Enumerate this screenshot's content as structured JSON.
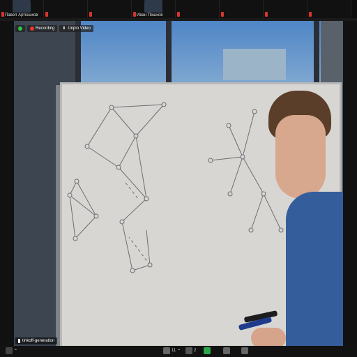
{
  "top_strip": {
    "tiles": [
      {
        "name": "Павел Артюшков"
      },
      {
        "name": ""
      },
      {
        "name": ""
      },
      {
        "name": "Иван Пешков"
      },
      {
        "name": ""
      },
      {
        "name": ""
      },
      {
        "name": ""
      },
      {
        "name": ""
      }
    ]
  },
  "main": {
    "badges": {
      "recording": "Recording",
      "unpin": "Unpin Video"
    },
    "speaker_tag": "tinkoff-generation"
  },
  "bottom_bar": {
    "participants_count": "11",
    "chat_count": "2"
  },
  "colors": {
    "recording_red": "#e53935",
    "security_green": "#28c840",
    "mic_muted_red": "#d9342b"
  }
}
